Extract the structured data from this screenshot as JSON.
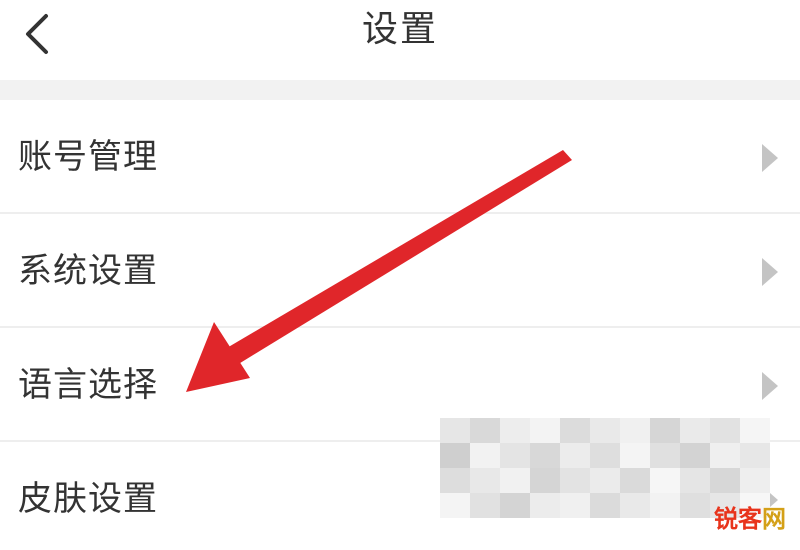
{
  "header": {
    "title": "设置",
    "back_icon": "chevron-left-icon"
  },
  "settings": {
    "items": [
      {
        "label": "账号管理",
        "icon": "chevron-right-icon"
      },
      {
        "label": "系统设置",
        "icon": "chevron-right-icon"
      },
      {
        "label": "语言选择",
        "icon": "chevron-right-icon"
      },
      {
        "label": "皮肤设置",
        "icon": "chevron-right-icon"
      }
    ]
  },
  "annotation": {
    "arrow_color": "#e0262a",
    "target_item": "语言选择"
  },
  "watermark": {
    "text_main": "锐客",
    "text_tail": "网"
  },
  "colors": {
    "separator": "#eeeeee",
    "gap_background": "#f2f2f2",
    "text": "#333333",
    "chevron": "#bbbbbb"
  }
}
